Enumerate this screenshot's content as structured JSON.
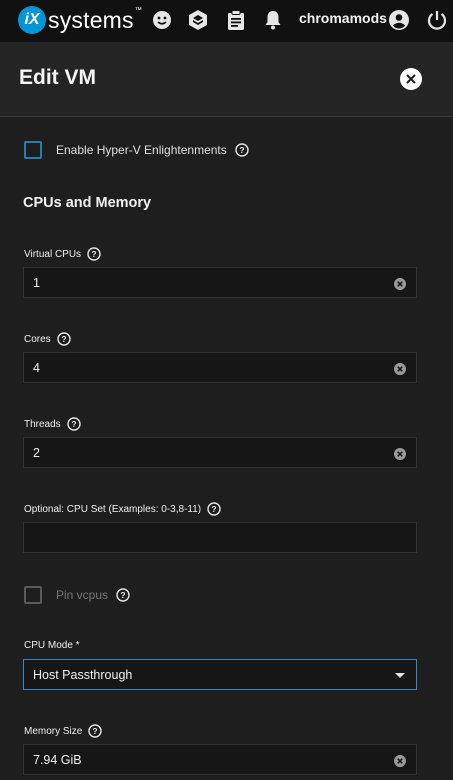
{
  "topbar": {
    "logo_mark": "iX",
    "logo_text": "systems",
    "logo_tm": "™",
    "username": "chromamods"
  },
  "header": {
    "title": "Edit VM"
  },
  "form": {
    "hyperv_label": "Enable Hyper-V Enlightenments",
    "section_title": "CPUs and Memory",
    "vcpus": {
      "label": "Virtual CPUs",
      "value": "1"
    },
    "cores": {
      "label": "Cores",
      "value": "4"
    },
    "threads": {
      "label": "Threads",
      "value": "2"
    },
    "cpuset": {
      "label": "Optional: CPU Set (Examples: 0-3,8-11)",
      "value": ""
    },
    "pin_vcpus_label": "Pin vcpus",
    "cpu_mode": {
      "label": "CPU Mode *",
      "value": "Host Passthrough"
    },
    "memory": {
      "label": "Memory Size",
      "value": "7.94 GiB"
    }
  },
  "colors": {
    "accent": "#1f7fb8",
    "brand": "#0095d5",
    "topbar": "#111111",
    "background": "#1e1e1e"
  }
}
